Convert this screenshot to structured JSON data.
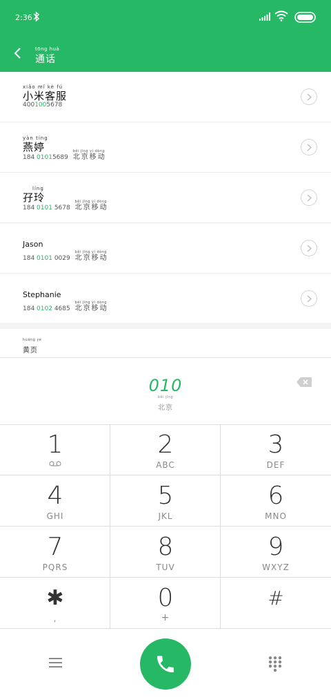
{
  "status": {
    "time": "2:36"
  },
  "header": {
    "title_pinyin": "tōng huà",
    "title": "通话"
  },
  "contacts": [
    {
      "name_pinyin": "xiǎo mǐ kè fú",
      "name": "小米客服",
      "num_pre": "400",
      "num_hl": "100",
      "num_post": "5678",
      "loc_pinyin": "",
      "loc": ""
    },
    {
      "name_pinyin": "yàn tíng",
      "name": "燕婷",
      "num_pre": "184 ",
      "num_hl": "0101",
      "num_post": "5689",
      "loc_pinyin": "běi jīng  yí dòng",
      "loc": "北京移动"
    },
    {
      "name_pinyin": "líng",
      "name": "孖玲",
      "num_pre": "184 ",
      "num_hl": "0101",
      "num_post": " 5678",
      "loc_pinyin": "běi jīng  yí dòng",
      "loc": "北京移动"
    },
    {
      "name_pinyin": "",
      "name": "Jason",
      "num_pre": "184 ",
      "num_hl": "0101",
      "num_post": " 0029",
      "loc_pinyin": "běi jīng  yí dòng",
      "loc": "北京移动"
    },
    {
      "name_pinyin": "",
      "name": "Stephanie",
      "num_pre": "184 ",
      "num_hl": "0102",
      "num_post": " 4685",
      "loc_pinyin": "běi jīng  yí dòng",
      "loc": "北京移动"
    }
  ],
  "yellow_pages": {
    "pinyin": "huáng yè",
    "label": "黄页"
  },
  "dial": {
    "number": "010",
    "loc_pinyin": "běi jīng",
    "loc": "北京"
  },
  "keys": [
    {
      "digit": "1",
      "letters": ""
    },
    {
      "digit": "2",
      "letters": "ABC"
    },
    {
      "digit": "3",
      "letters": "DEF"
    },
    {
      "digit": "4",
      "letters": "GHI"
    },
    {
      "digit": "5",
      "letters": "JKL"
    },
    {
      "digit": "6",
      "letters": "MNO"
    },
    {
      "digit": "7",
      "letters": "PQRS"
    },
    {
      "digit": "8",
      "letters": "TUV"
    },
    {
      "digit": "9",
      "letters": "WXYZ"
    },
    {
      "digit": "✱",
      "letters": ","
    },
    {
      "digit": "0",
      "letters": "+"
    },
    {
      "digit": "#",
      "letters": ""
    }
  ],
  "icons": {
    "back": "chevron-left-icon",
    "bluetooth": "bluetooth-icon",
    "signal": "signal-icon",
    "wifi": "wifi-icon",
    "battery": "battery-icon",
    "detail": "chevron-right-icon",
    "backspace": "backspace-icon",
    "voicemail": "voicemail-icon",
    "menu": "menu-icon",
    "call": "phone-icon",
    "dialpad": "dialpad-icon"
  },
  "colors": {
    "accent": "#27b865"
  }
}
